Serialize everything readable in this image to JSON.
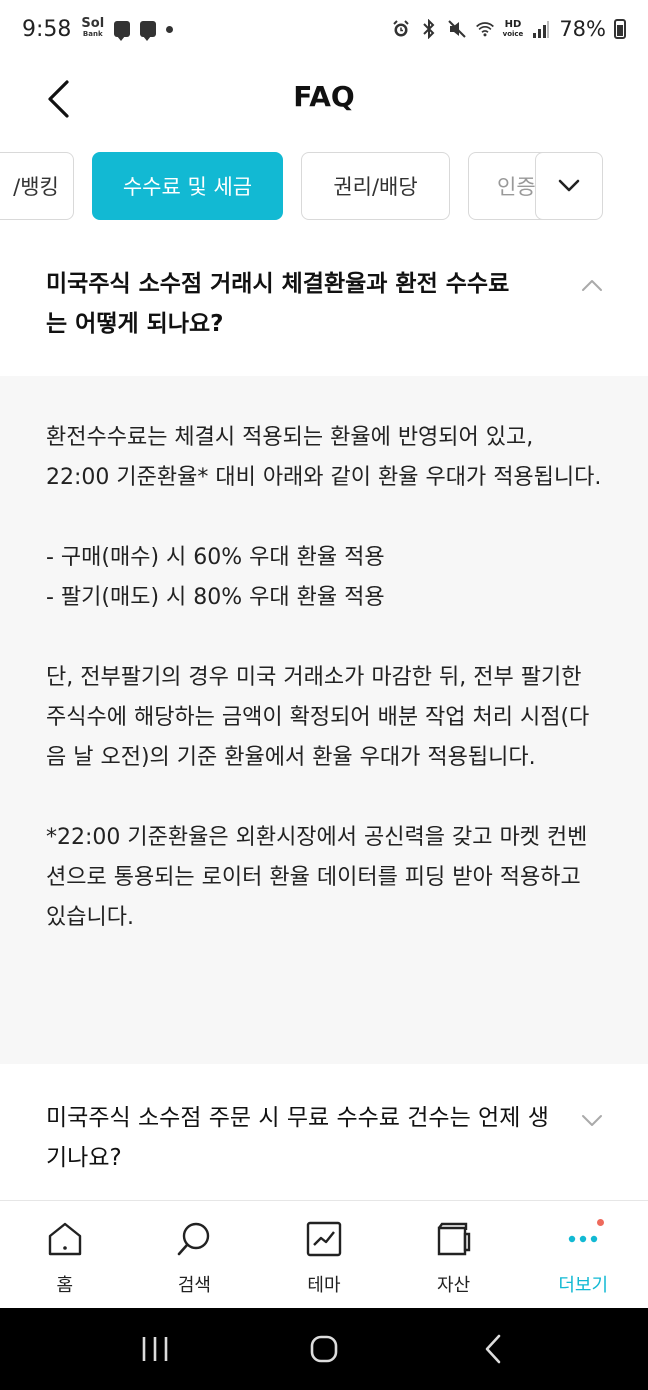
{
  "status_bar": {
    "time": "9:58",
    "app_logo_text": "Sol",
    "app_logo_sub": "Bank",
    "hd_voice": "HD",
    "battery": "78%"
  },
  "header": {
    "title": "FAQ"
  },
  "tabs": [
    {
      "label": "/뱅킹",
      "active": false
    },
    {
      "label": "수수료 및 세금",
      "active": true
    },
    {
      "label": "권리/배당",
      "active": false
    },
    {
      "label": "인증",
      "active": false
    }
  ],
  "faq": [
    {
      "question": "미국주식 소수점 거래시 체결환율과 환전 수수료는 어떻게 되나요?",
      "expanded": true,
      "answer": "환전수수료는 체결시 적용되는 환율에 반영되어 있고, 22:00 기준환율* 대비 아래와 같이 환율 우대가 적용됩니다.\n\n- 구매(매수) 시 60% 우대 환율 적용\n- 팔기(매도) 시 80% 우대 환율 적용\n\n단, 전부팔기의 경우 미국 거래소가 마감한 뒤, 전부 팔기한 주식수에 해당하는 금액이 확정되어 배분 작업 처리 시점(다음 날 오전)의 기준 환율에서 환율 우대가 적용됩니다.\n\n*22:00 기준환율은 외환시장에서 공신력을 갖고 마켓 컨벤션으로 통용되는 로이터 환율 데이터를 피딩 받아 적용하고 있습니다."
    },
    {
      "question": "미국주식 소수점 주문 시 무료 수수료 건수는 언제 생기나요?",
      "expanded": false
    }
  ],
  "bottom_nav": [
    {
      "label": "홈",
      "icon": "home-icon"
    },
    {
      "label": "검색",
      "icon": "search-icon"
    },
    {
      "label": "테마",
      "icon": "chart-icon"
    },
    {
      "label": "자산",
      "icon": "wallet-icon"
    },
    {
      "label": "더보기",
      "icon": "more-icon",
      "active": true
    }
  ],
  "colors": {
    "accent": "#12b9d3",
    "answer_bg": "#f7f7f7",
    "notification_dot": "#ee6a5c"
  }
}
